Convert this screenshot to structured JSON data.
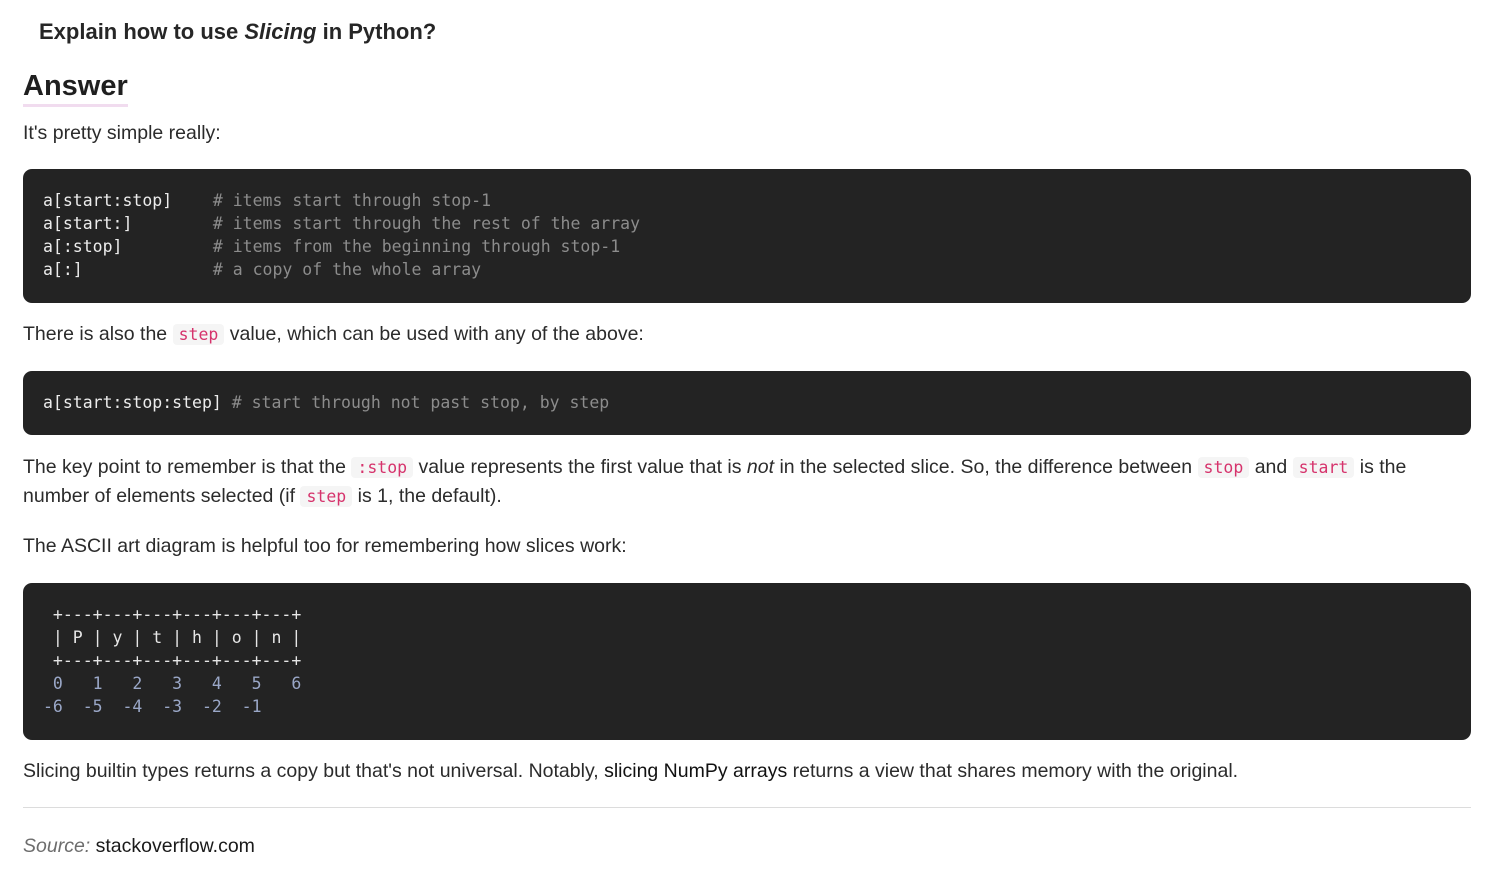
{
  "question": {
    "prefix": "Explain how to use ",
    "emphasis": "Slicing",
    "suffix": " in Python?"
  },
  "answer_heading": "Answer",
  "intro": "It's pretty simple really:",
  "code_block_1": [
    {
      "expr": "a[start:stop]",
      "comment": "# items start through stop-1"
    },
    {
      "expr": "a[start:]",
      "comment": "# items start through the rest of the array"
    },
    {
      "expr": "a[:stop]",
      "comment": "# items from the beginning through stop-1"
    },
    {
      "expr": "a[:]",
      "comment": "# a copy of the whole array"
    }
  ],
  "step_paragraph": {
    "before": "There is also the ",
    "code": "step",
    "after": " value, which can be used with any of the above:"
  },
  "code_block_2": {
    "expr": "a[start:stop:step]",
    "comment": "# start through not past stop, by step"
  },
  "key_paragraph": {
    "t1": "The key point to remember is that the ",
    "c1": ":stop",
    "t2": " value represents the first value that is ",
    "em": "not",
    "t3": " in the selected slice. So, the difference between ",
    "c2": "stop",
    "t4": " and ",
    "c3": "start",
    "t5": " is the number of elements selected (if ",
    "c4": "step",
    "t6": " is 1, the default)."
  },
  "ascii_paragraph": "The ASCII art diagram is helpful too for remembering how slices work:",
  "ascii_art": {
    "border": " +---+---+---+---+---+---+",
    "letters": " | P | y | t | h | o | n |",
    "positive": " 0   1   2   3   4   5   6",
    "negative": "-6  -5  -4  -3  -2  -1"
  },
  "final_paragraph": {
    "before": "Slicing builtin types returns a copy but that's not universal. Notably, ",
    "link": "slicing NumPy arrays",
    "after": " returns a view that shares memory with the original."
  },
  "source": {
    "label": "Source:",
    "value": "stackoverflow.com"
  }
}
